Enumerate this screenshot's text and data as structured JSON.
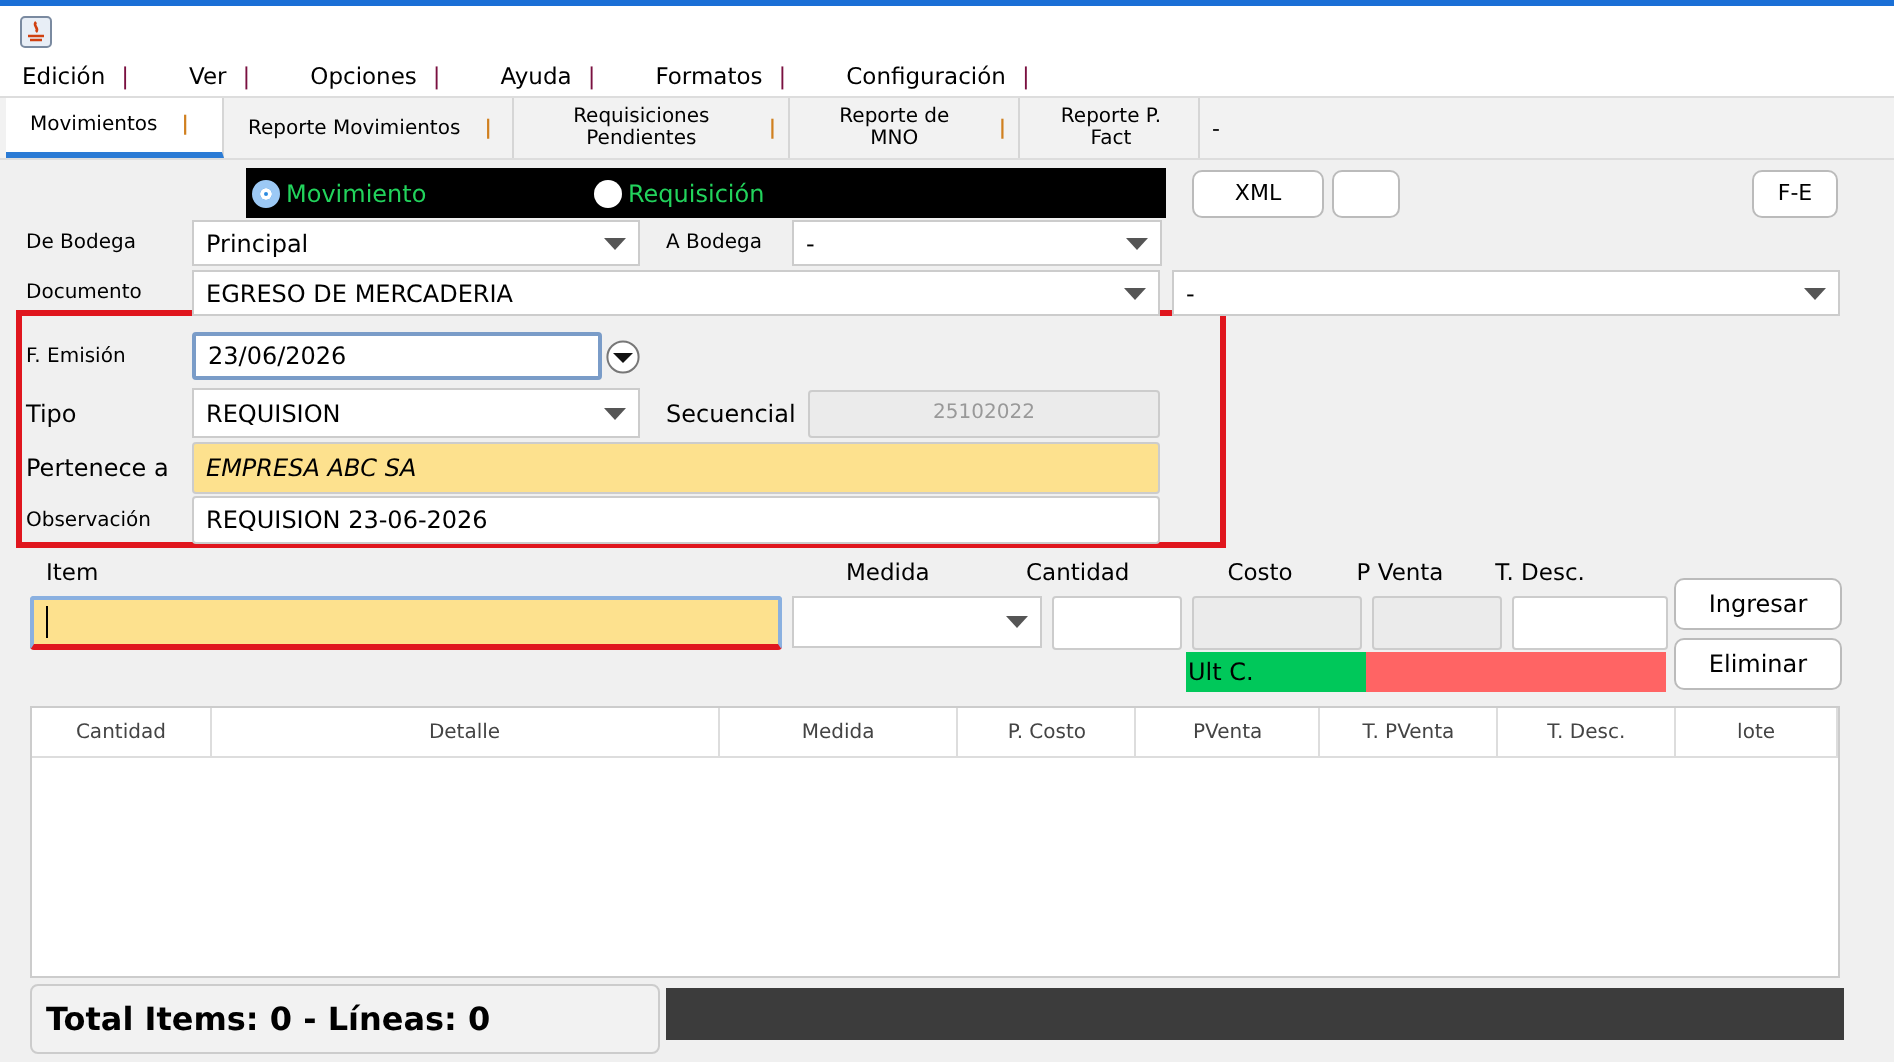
{
  "menu": [
    {
      "label": "Edición",
      "separator": "|"
    },
    {
      "label": "Ver",
      "separator": "|"
    },
    {
      "label": "Opciones",
      "separator": "|"
    },
    {
      "label": "Ayuda",
      "separator": "|"
    },
    {
      "label": "Formatos",
      "separator": "|"
    },
    {
      "label": "Configuración",
      "separator": "|"
    }
  ],
  "tabs": [
    {
      "label": "Movimientos",
      "separator": "|",
      "selected": true
    },
    {
      "label": "Reporte Movimientos",
      "separator": "|",
      "selected": false
    },
    {
      "label": "Requisiciones Pendientes",
      "separator": "|",
      "selected": false
    },
    {
      "label": "Reporte de MNO",
      "separator": "|",
      "selected": false
    },
    {
      "label": "Reporte P. Fact",
      "selected": false
    }
  ],
  "tabs_trailer": "-",
  "radios": [
    {
      "label": "Movimiento",
      "selected": true
    },
    {
      "label": "Requisición",
      "selected": false
    }
  ],
  "buttons": {
    "xml": "XML",
    "fe": "F-E"
  },
  "form": {
    "de_bodega": {
      "label": "De Bodega",
      "value": "Principal"
    },
    "a_bodega": {
      "label": "A Bodega",
      "value": "-"
    },
    "documento": {
      "label": "Documento",
      "value": "EGRESO DE MERCADERIA",
      "extra_value": "-"
    },
    "f_emision": {
      "label": "F. Emisión",
      "value": "23/06/2026"
    },
    "tipo": {
      "label": "Tipo",
      "value": "REQUISION"
    },
    "secuencial": {
      "label": "Secuencial",
      "value": "25102022",
      "disabled": true
    },
    "pertenece": {
      "label": "Pertenece a",
      "value": "EMPRESA ABC SA"
    },
    "observacion": {
      "label": "Observación",
      "value": "REQUISION 23-06-2026"
    }
  },
  "entry": {
    "labels": [
      "Item",
      "Medida",
      "Cantidad",
      "Costo",
      "P Venta",
      "T. Desc."
    ],
    "ingresar": "Ingresar",
    "eliminar": "Eliminar",
    "ult_c": "Ult C."
  },
  "table": {
    "columns": [
      "Cantidad",
      "Detalle",
      "Medida",
      "P. Costo",
      "PVenta",
      "T. PVenta",
      "T. Desc.",
      "lote"
    ]
  },
  "status_bar": {
    "total": "Total Items: 0 - Líneas: 0"
  }
}
